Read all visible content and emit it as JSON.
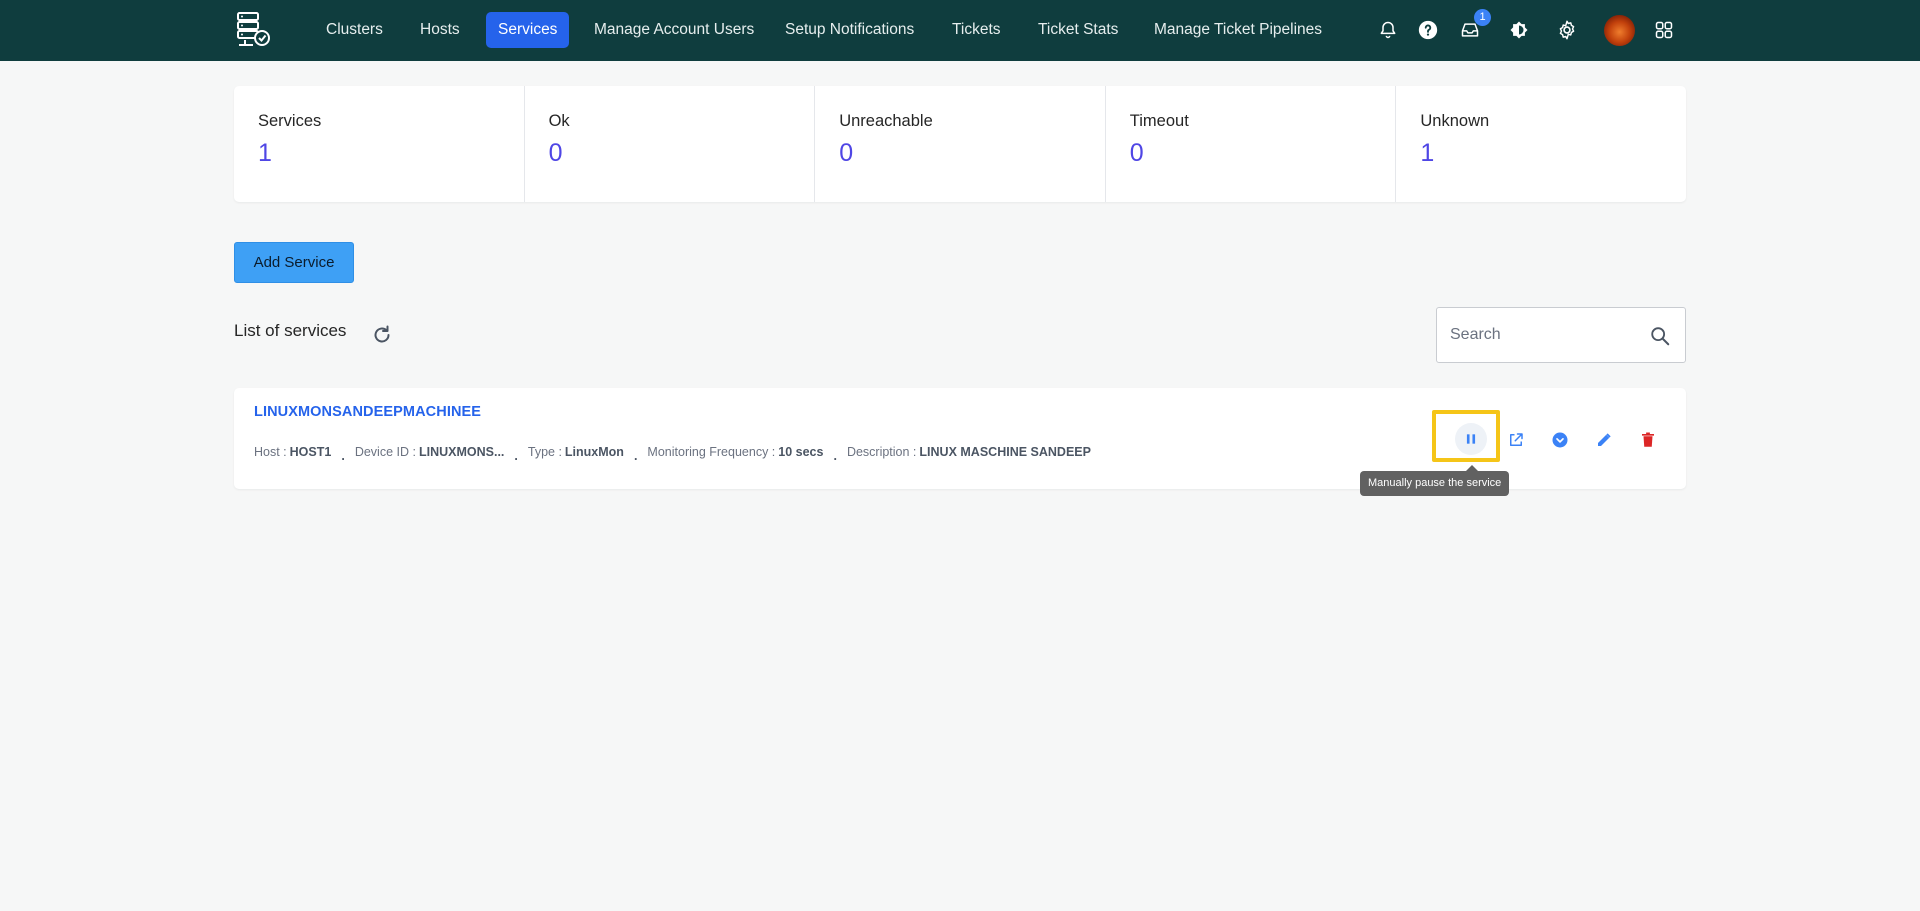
{
  "nav": {
    "items": [
      {
        "label": "Clusters",
        "active": false
      },
      {
        "label": "Hosts",
        "active": false
      },
      {
        "label": "Services",
        "active": true
      },
      {
        "label": "Manage Account Users",
        "active": false
      },
      {
        "label": "Setup Notifications",
        "active": false
      },
      {
        "label": "Tickets",
        "active": false
      },
      {
        "label": "Ticket Stats",
        "active": false
      },
      {
        "label": "Manage Ticket Pipelines",
        "active": false
      }
    ],
    "icons": [
      "bell-icon",
      "help-icon",
      "inbox-icon",
      "theme-toggle-icon",
      "gear-icon",
      "avatar",
      "apps-grid-icon"
    ],
    "inbox_badge": "1"
  },
  "stats": [
    {
      "label": "Services",
      "value": "1"
    },
    {
      "label": "Ok",
      "value": "0"
    },
    {
      "label": "Unreachable",
      "value": "0"
    },
    {
      "label": "Timeout",
      "value": "0"
    },
    {
      "label": "Unknown",
      "value": "1"
    }
  ],
  "add_service_label": "Add Service",
  "list_title": "List of services",
  "search": {
    "placeholder": "Search"
  },
  "service": {
    "name": "LINUXMONSANDEEPMACHINEE",
    "host_key": "Host :",
    "host": "HOST1",
    "device_key": "Device ID :",
    "device": "LINUXMONS...",
    "type_key": "Type :",
    "type": "LinuxMon",
    "freq_key": "Monitoring Frequency :",
    "freq": "10 secs",
    "desc_key": "Description :",
    "desc": "LINUX MASCHINE SANDEEP",
    "separator": "."
  },
  "tooltip": "Manually pause the service",
  "colors": {
    "topbar": "#0f3d3e",
    "accent": "#2563eb",
    "stat_value": "#4f46e5",
    "add_button": "#3ea0f5",
    "highlight": "#f5c518",
    "delete": "#dc2626"
  }
}
